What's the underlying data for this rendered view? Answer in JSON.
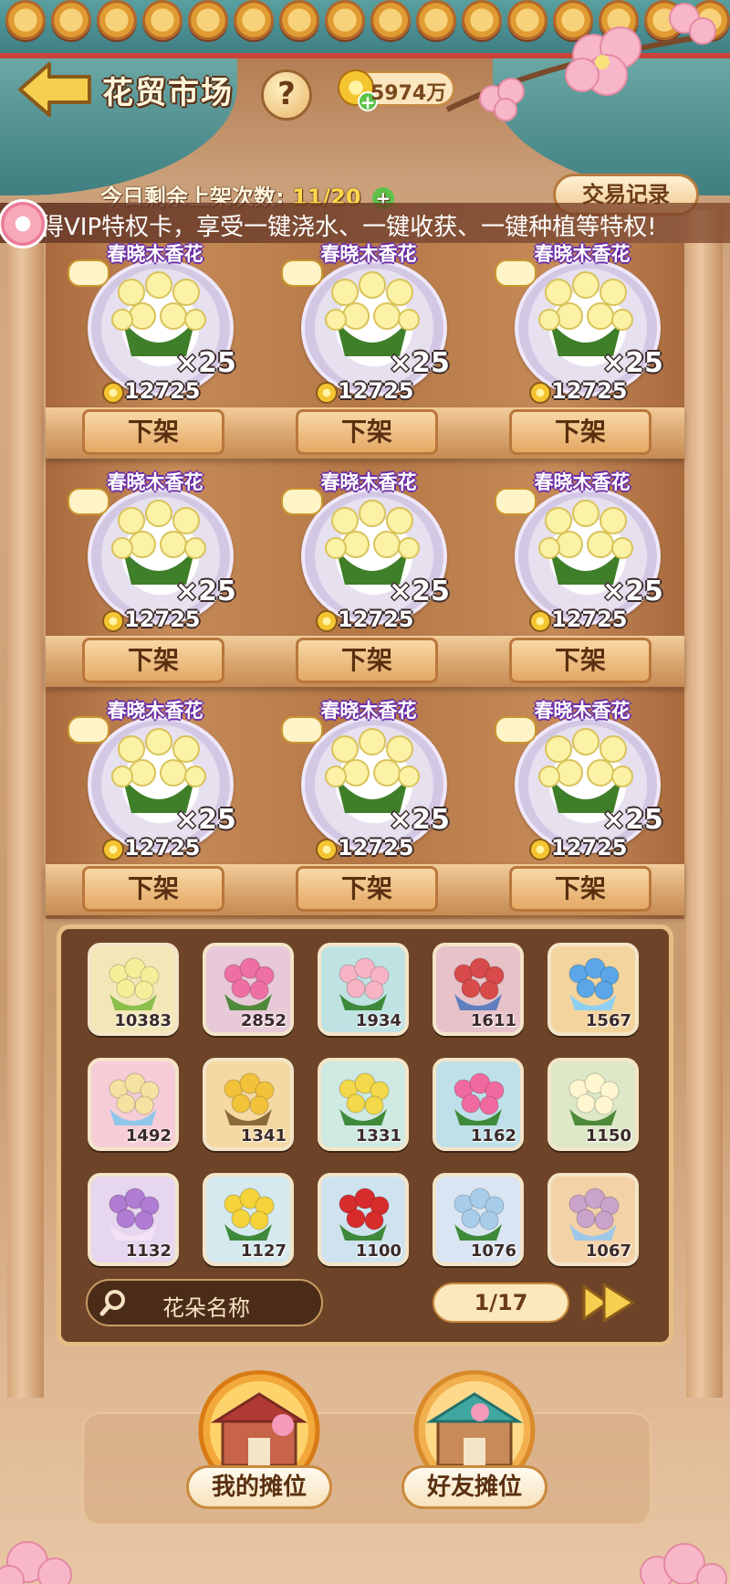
{
  "header": {
    "title": "花贸市场",
    "help": "?",
    "coins": "5974万",
    "daily_label": "今日剩余上架次数:",
    "daily_count": "11/20",
    "trade_record": "交易记录"
  },
  "marquee": "得VIP特权卡，享受一键浇水、一键收获、一键种植等特权!",
  "shelves": [
    {
      "name": "春晓木香花",
      "qty": "×25",
      "price": "12725",
      "action": "下架"
    },
    {
      "name": "春晓木香花",
      "qty": "×25",
      "price": "12725",
      "action": "下架"
    },
    {
      "name": "春晓木香花",
      "qty": "×25",
      "price": "12725",
      "action": "下架"
    },
    {
      "name": "春晓木香花",
      "qty": "×25",
      "price": "12725",
      "action": "下架"
    },
    {
      "name": "春晓木香花",
      "qty": "×25",
      "price": "12725",
      "action": "下架"
    },
    {
      "name": "春晓木香花",
      "qty": "×25",
      "price": "12725",
      "action": "下架"
    },
    {
      "name": "春晓木香花",
      "qty": "×25",
      "price": "12725",
      "action": "下架"
    },
    {
      "name": "春晓木香花",
      "qty": "×25",
      "price": "12725",
      "action": "下架"
    },
    {
      "name": "春晓木香花",
      "qty": "×25",
      "price": "12725",
      "action": "下架"
    }
  ],
  "inventory": [
    {
      "count": "10383",
      "bg": "#f3e7b8",
      "flower": "#f6ef9a",
      "leaf": "#8abf4a"
    },
    {
      "count": "2852",
      "bg": "#e8c9d7",
      "flower": "#ee6fa4",
      "leaf": "#4f8a3a"
    },
    {
      "count": "1934",
      "bg": "#bfe3e3",
      "flower": "#f7b4c5",
      "leaf": "#3f8a3a"
    },
    {
      "count": "1611",
      "bg": "#e7c3c9",
      "flower": "#d94a4a",
      "leaf": "#5f7fbf"
    },
    {
      "count": "1567",
      "bg": "#f3d49c",
      "flower": "#5aa6e8",
      "leaf": "#8fd0f2"
    },
    {
      "count": "1492",
      "bg": "#f6cdd7",
      "flower": "#f5e2a0",
      "leaf": "#8fc8e8"
    },
    {
      "count": "1341",
      "bg": "#f5d9a2",
      "flower": "#f1c23a",
      "leaf": "#8a6a3a"
    },
    {
      "count": "1331",
      "bg": "#cfe9e3",
      "flower": "#f2d84a",
      "leaf": "#3f8a3a"
    },
    {
      "count": "1162",
      "bg": "#bfe0ea",
      "flower": "#f06aa0",
      "leaf": "#3f8a3a"
    },
    {
      "count": "1150",
      "bg": "#dde8c8",
      "flower": "#fff7d0",
      "leaf": "#4f8a3a"
    },
    {
      "count": "1132",
      "bg": "#e6d6ef",
      "flower": "#b07bd2",
      "leaf": "#f3e2f5"
    },
    {
      "count": "1127",
      "bg": "#d5e9ee",
      "flower": "#f5d33a",
      "leaf": "#3f8a3a"
    },
    {
      "count": "1100",
      "bg": "#cfe3ef",
      "flower": "#d82c2c",
      "leaf": "#3f8a3a"
    },
    {
      "count": "1076",
      "bg": "#d9e5f2",
      "flower": "#a8cdea",
      "leaf": "#3f8a3a"
    },
    {
      "count": "1067",
      "bg": "#f4d2a8",
      "flower": "#c9a3c9",
      "leaf": "#9fc8e8"
    }
  ],
  "search": {
    "placeholder": "花朵名称"
  },
  "pagination": "1/17",
  "tabs": {
    "my_stall": "我的摊位",
    "friend_stall": "好友摊位"
  },
  "colors": {
    "name_outline": "#6a2ea8",
    "coin": "#f4c531",
    "panel": "#6e4428"
  }
}
